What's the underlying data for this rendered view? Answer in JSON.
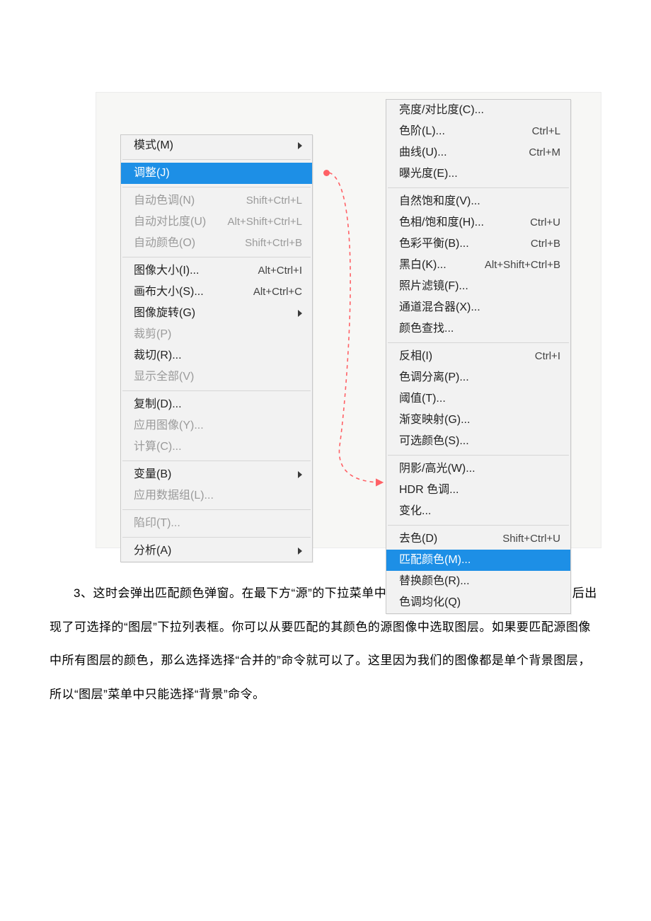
{
  "menu_left_groups": [
    [
      {
        "label": "模式(M)",
        "shortcut": "",
        "submenu": true,
        "disabled": false,
        "highlight": false,
        "id": "mode"
      }
    ],
    [
      {
        "label": "调整(J)",
        "shortcut": "",
        "submenu": false,
        "disabled": false,
        "highlight": true,
        "id": "adjust"
      }
    ],
    [
      {
        "label": "自动色调(N)",
        "shortcut": "Shift+Ctrl+L",
        "submenu": false,
        "disabled": true,
        "highlight": false,
        "id": "auto-tone"
      },
      {
        "label": "自动对比度(U)",
        "shortcut": "Alt+Shift+Ctrl+L",
        "submenu": false,
        "disabled": true,
        "highlight": false,
        "id": "auto-contrast"
      },
      {
        "label": "自动颜色(O)",
        "shortcut": "Shift+Ctrl+B",
        "submenu": false,
        "disabled": true,
        "highlight": false,
        "id": "auto-color"
      }
    ],
    [
      {
        "label": "图像大小(I)...",
        "shortcut": "Alt+Ctrl+I",
        "submenu": false,
        "disabled": false,
        "highlight": false,
        "id": "image-size"
      },
      {
        "label": "画布大小(S)...",
        "shortcut": "Alt+Ctrl+C",
        "submenu": false,
        "disabled": false,
        "highlight": false,
        "id": "canvas-size"
      },
      {
        "label": "图像旋转(G)",
        "shortcut": "",
        "submenu": true,
        "disabled": false,
        "highlight": false,
        "id": "image-rotate"
      },
      {
        "label": "裁剪(P)",
        "shortcut": "",
        "submenu": false,
        "disabled": true,
        "highlight": false,
        "id": "crop"
      },
      {
        "label": "裁切(R)...",
        "shortcut": "",
        "submenu": false,
        "disabled": false,
        "highlight": false,
        "id": "trim"
      },
      {
        "label": "显示全部(V)",
        "shortcut": "",
        "submenu": false,
        "disabled": true,
        "highlight": false,
        "id": "reveal-all"
      }
    ],
    [
      {
        "label": "复制(D)...",
        "shortcut": "",
        "submenu": false,
        "disabled": false,
        "highlight": false,
        "id": "duplicate"
      },
      {
        "label": "应用图像(Y)...",
        "shortcut": "",
        "submenu": false,
        "disabled": true,
        "highlight": false,
        "id": "apply-image"
      },
      {
        "label": "计算(C)...",
        "shortcut": "",
        "submenu": false,
        "disabled": true,
        "highlight": false,
        "id": "calculations"
      }
    ],
    [
      {
        "label": "变量(B)",
        "shortcut": "",
        "submenu": true,
        "disabled": false,
        "highlight": false,
        "id": "variables"
      },
      {
        "label": "应用数据组(L)...",
        "shortcut": "",
        "submenu": false,
        "disabled": true,
        "highlight": false,
        "id": "apply-data-set"
      }
    ],
    [
      {
        "label": "陷印(T)...",
        "shortcut": "",
        "submenu": false,
        "disabled": true,
        "highlight": false,
        "id": "trap"
      }
    ],
    [
      {
        "label": "分析(A)",
        "shortcut": "",
        "submenu": true,
        "disabled": false,
        "highlight": false,
        "id": "analysis"
      }
    ]
  ],
  "menu_right_groups": [
    [
      {
        "label": "亮度/对比度(C)...",
        "shortcut": "",
        "submenu": false,
        "disabled": false,
        "highlight": false,
        "id": "brightness-contrast"
      },
      {
        "label": "色阶(L)...",
        "shortcut": "Ctrl+L",
        "submenu": false,
        "disabled": false,
        "highlight": false,
        "id": "levels"
      },
      {
        "label": "曲线(U)...",
        "shortcut": "Ctrl+M",
        "submenu": false,
        "disabled": false,
        "highlight": false,
        "id": "curves"
      },
      {
        "label": "曝光度(E)...",
        "shortcut": "",
        "submenu": false,
        "disabled": false,
        "highlight": false,
        "id": "exposure"
      }
    ],
    [
      {
        "label": "自然饱和度(V)...",
        "shortcut": "",
        "submenu": false,
        "disabled": false,
        "highlight": false,
        "id": "vibrance"
      },
      {
        "label": "色相/饱和度(H)...",
        "shortcut": "Ctrl+U",
        "submenu": false,
        "disabled": false,
        "highlight": false,
        "id": "hue-saturation"
      },
      {
        "label": "色彩平衡(B)...",
        "shortcut": "Ctrl+B",
        "submenu": false,
        "disabled": false,
        "highlight": false,
        "id": "color-balance"
      },
      {
        "label": "黑白(K)...",
        "shortcut": "Alt+Shift+Ctrl+B",
        "submenu": false,
        "disabled": false,
        "highlight": false,
        "id": "black-white"
      },
      {
        "label": "照片滤镜(F)...",
        "shortcut": "",
        "submenu": false,
        "disabled": false,
        "highlight": false,
        "id": "photo-filter"
      },
      {
        "label": "通道混合器(X)...",
        "shortcut": "",
        "submenu": false,
        "disabled": false,
        "highlight": false,
        "id": "channel-mixer"
      },
      {
        "label": "颜色查找...",
        "shortcut": "",
        "submenu": false,
        "disabled": false,
        "highlight": false,
        "id": "color-lookup"
      }
    ],
    [
      {
        "label": "反相(I)",
        "shortcut": "Ctrl+I",
        "submenu": false,
        "disabled": false,
        "highlight": false,
        "id": "invert"
      },
      {
        "label": "色调分离(P)...",
        "shortcut": "",
        "submenu": false,
        "disabled": false,
        "highlight": false,
        "id": "posterize"
      },
      {
        "label": "阈值(T)...",
        "shortcut": "",
        "submenu": false,
        "disabled": false,
        "highlight": false,
        "id": "threshold"
      },
      {
        "label": "渐变映射(G)...",
        "shortcut": "",
        "submenu": false,
        "disabled": false,
        "highlight": false,
        "id": "gradient-map"
      },
      {
        "label": "可选颜色(S)...",
        "shortcut": "",
        "submenu": false,
        "disabled": false,
        "highlight": false,
        "id": "selective-color"
      }
    ],
    [
      {
        "label": "阴影/高光(W)...",
        "shortcut": "",
        "submenu": false,
        "disabled": false,
        "highlight": false,
        "id": "shadows-highlights"
      },
      {
        "label": "HDR 色调...",
        "shortcut": "",
        "submenu": false,
        "disabled": false,
        "highlight": false,
        "id": "hdr-toning"
      },
      {
        "label": "变化...",
        "shortcut": "",
        "submenu": false,
        "disabled": false,
        "highlight": false,
        "id": "variations"
      }
    ],
    [
      {
        "label": "去色(D)",
        "shortcut": "Shift+Ctrl+U",
        "submenu": false,
        "disabled": false,
        "highlight": false,
        "id": "desaturate"
      },
      {
        "label": "匹配颜色(M)...",
        "shortcut": "",
        "submenu": false,
        "disabled": false,
        "highlight": true,
        "id": "match-color"
      },
      {
        "label": "替换颜色(R)...",
        "shortcut": "",
        "submenu": false,
        "disabled": false,
        "highlight": false,
        "id": "replace-color"
      },
      {
        "label": "色调均化(Q)",
        "shortcut": "",
        "submenu": false,
        "disabled": false,
        "highlight": false,
        "id": "equalize"
      }
    ]
  ],
  "paragraph": "3、这时会弹出匹配颜色弹窗。在最下方“源”的下拉菜单中找到需要的颜色的图片，选择图片后出现了可选择的“图层”下拉列表框。你可以从要匹配的其颜色的源图像中选取图层。如果要匹配源图像中所有图层的颜色，那么选择选择“合并的”命令就可以了。这里因为我们的图像都是单个背景图层，所以“图层”菜单中只能选择“背景”命令。"
}
